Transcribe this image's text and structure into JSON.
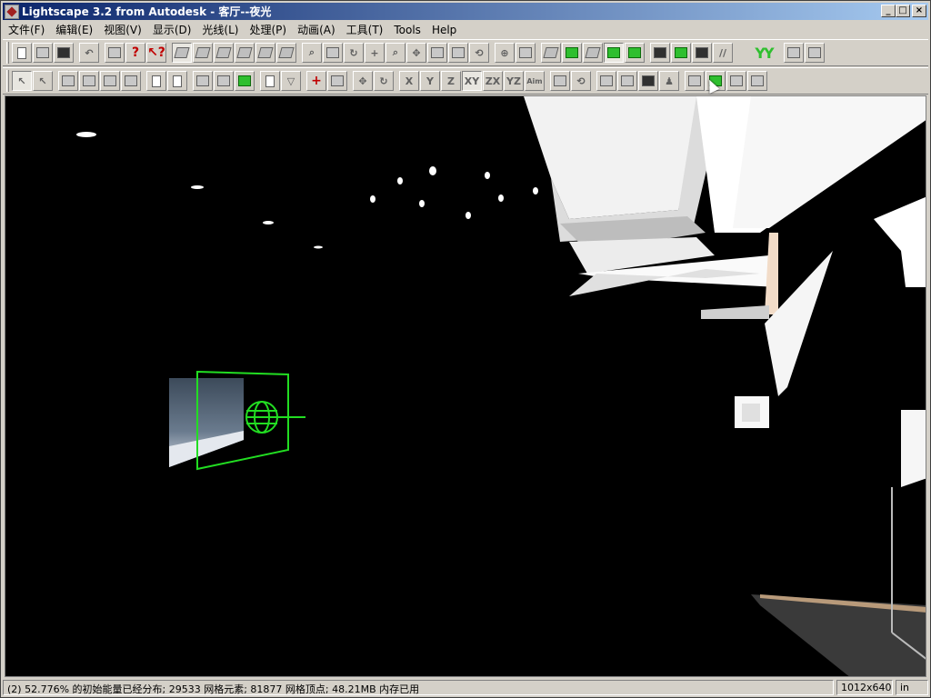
{
  "window": {
    "title": "Lightscape 3.2 from Autodesk - 客厅--夜光"
  },
  "menubar": {
    "items": [
      {
        "label": "文件(F)"
      },
      {
        "label": "编辑(E)"
      },
      {
        "label": "视图(V)"
      },
      {
        "label": "显示(D)"
      },
      {
        "label": "光线(L)"
      },
      {
        "label": "处理(P)"
      },
      {
        "label": "动画(A)"
      },
      {
        "label": "工具(T)"
      },
      {
        "label": "Tools"
      },
      {
        "label": "Help"
      }
    ]
  },
  "toolbar2": {
    "axis_labels": {
      "x": "X",
      "y": "Y",
      "z": "Z",
      "xy": "XY",
      "zx": "ZX",
      "yz": "YZ",
      "aim": "Aim"
    }
  },
  "statusbar": {
    "message": "(2) 52.776% 的初始能量已经分布; 29533 网格元素; 81877 网格顶点; 48.21MB 内存已用",
    "size": "1012x640",
    "unit": "in"
  },
  "colors": {
    "titlebar_start": "#0a246a",
    "titlebar_end": "#a6caf0",
    "accent_green": "#2fbf2f",
    "light_gizmo": "#22dd22"
  }
}
